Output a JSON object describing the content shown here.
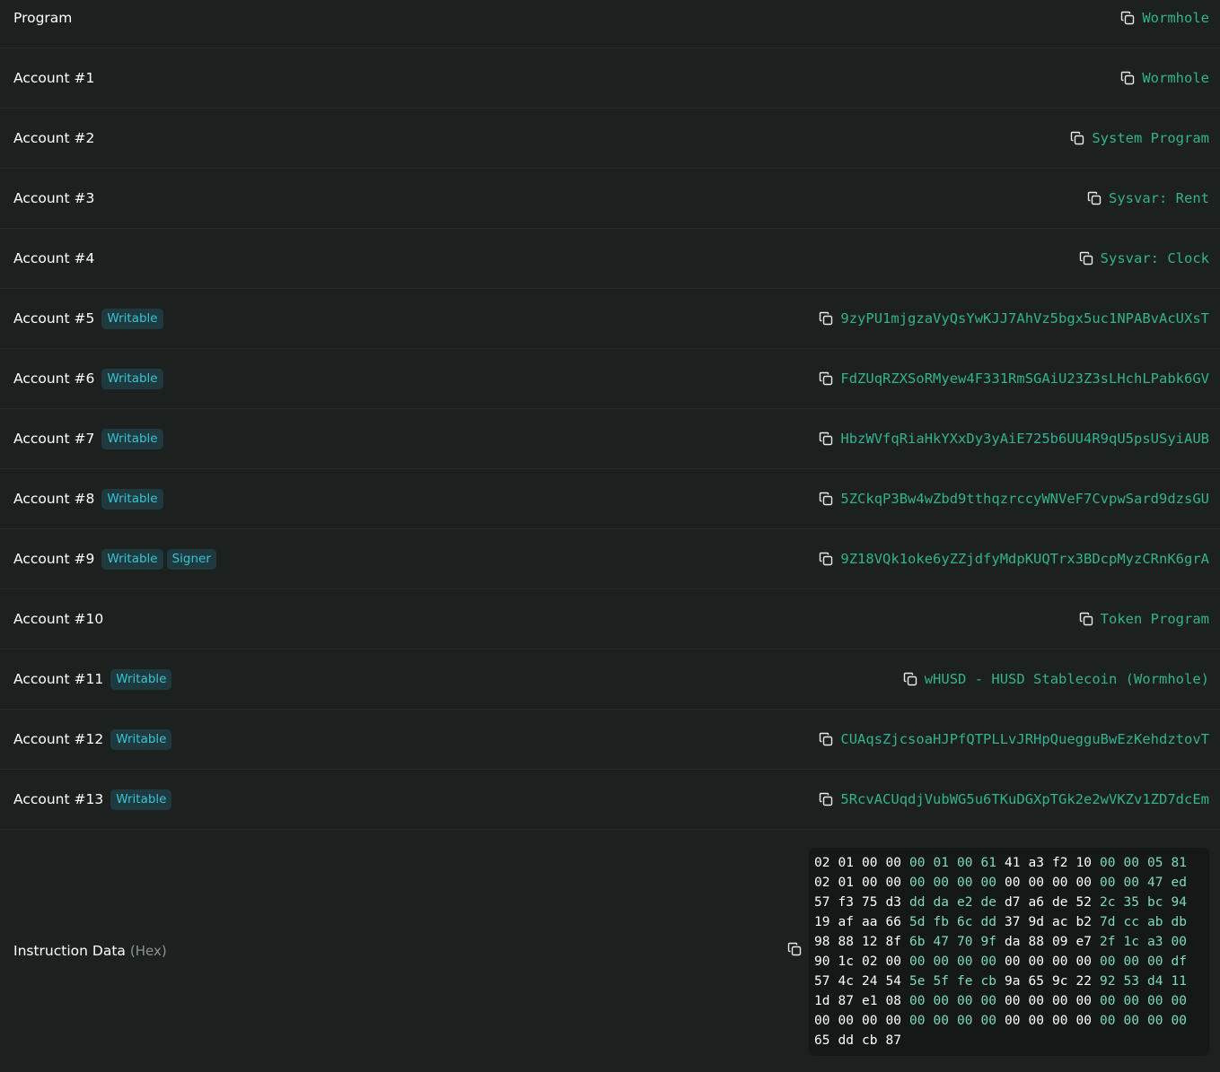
{
  "rows": [
    {
      "label": "Program",
      "badges": [],
      "value": "Wormhole"
    },
    {
      "label": "Account #1",
      "badges": [],
      "value": "Wormhole"
    },
    {
      "label": "Account #2",
      "badges": [],
      "value": "System Program"
    },
    {
      "label": "Account #3",
      "badges": [],
      "value": "Sysvar: Rent"
    },
    {
      "label": "Account #4",
      "badges": [],
      "value": "Sysvar: Clock"
    },
    {
      "label": "Account #5",
      "badges": [
        "Writable"
      ],
      "value": "9zyPU1mjgzaVyQsYwKJJ7AhVz5bgx5uc1NPABvAcUXsT"
    },
    {
      "label": "Account #6",
      "badges": [
        "Writable"
      ],
      "value": "FdZUqRZXSoRMyew4F331RmSGAiU23Z3sLHchLPabk6GV"
    },
    {
      "label": "Account #7",
      "badges": [
        "Writable"
      ],
      "value": "HbzWVfqRiaHkYXxDy3yAiE725b6UU4R9qU5psUSyiAUB"
    },
    {
      "label": "Account #8",
      "badges": [
        "Writable"
      ],
      "value": "5ZCkqP3Bw4wZbd9tthqzrccyWNVeF7CvpwSard9dzsGU"
    },
    {
      "label": "Account #9",
      "badges": [
        "Writable",
        "Signer"
      ],
      "value": "9Z18VQk1oke6yZZjdfyMdpKUQTrx3BDcpMyzCRnK6grA"
    },
    {
      "label": "Account #10",
      "badges": [],
      "value": "Token Program"
    },
    {
      "label": "Account #11",
      "badges": [
        "Writable"
      ],
      "value": "wHUSD - HUSD Stablecoin (Wormhole)"
    },
    {
      "label": "Account #12",
      "badges": [
        "Writable"
      ],
      "value": "CUAqsZjcsoaHJPfQTPLLvJRHpQuegguBwEzKehdztovT"
    },
    {
      "label": "Account #13",
      "badges": [
        "Writable"
      ],
      "value": "5RcvACUqdjVubWG5u6TKuDGXpTGk2e2wVKZv1ZD7dcEm"
    }
  ],
  "instruction_data": {
    "label": "Instruction Data",
    "format": "(Hex)",
    "hex_lines": [
      "02 01 00 00 00 01 00 61 41 a3 f2 10 00 00 05 81",
      "02 01 00 00 00 00 00 00 00 00 00 00 00 00 47 ed",
      "57 f3 75 d3 dd da e2 de d7 a6 de 52 2c 35 bc 94",
      "19 af aa 66 5d fb 6c dd 37 9d ac b2 7d cc ab db",
      "98 88 12 8f 6b 47 70 9f da 88 09 e7 2f 1c a3 00",
      "90 1c 02 00 00 00 00 00 00 00 00 00 00 00 00 df",
      "57 4c 24 54 5e 5f fe cb 9a 65 9c 22 92 53 d4 11",
      "1d 87 e1 08 00 00 00 00 00 00 00 00 00 00 00 00",
      "00 00 00 00 00 00 00 00 00 00 00 00 00 00 00 00",
      "65 dd cb 87"
    ]
  },
  "colors": {
    "background": "#1c2120",
    "link": "#33b28c",
    "badge_bg": "#1f3a3e",
    "badge_text": "#39c2d4",
    "hex_white": "#ffffff",
    "hex_green": "#7fd9bd"
  },
  "icons": {
    "copy": "copy-icon"
  }
}
